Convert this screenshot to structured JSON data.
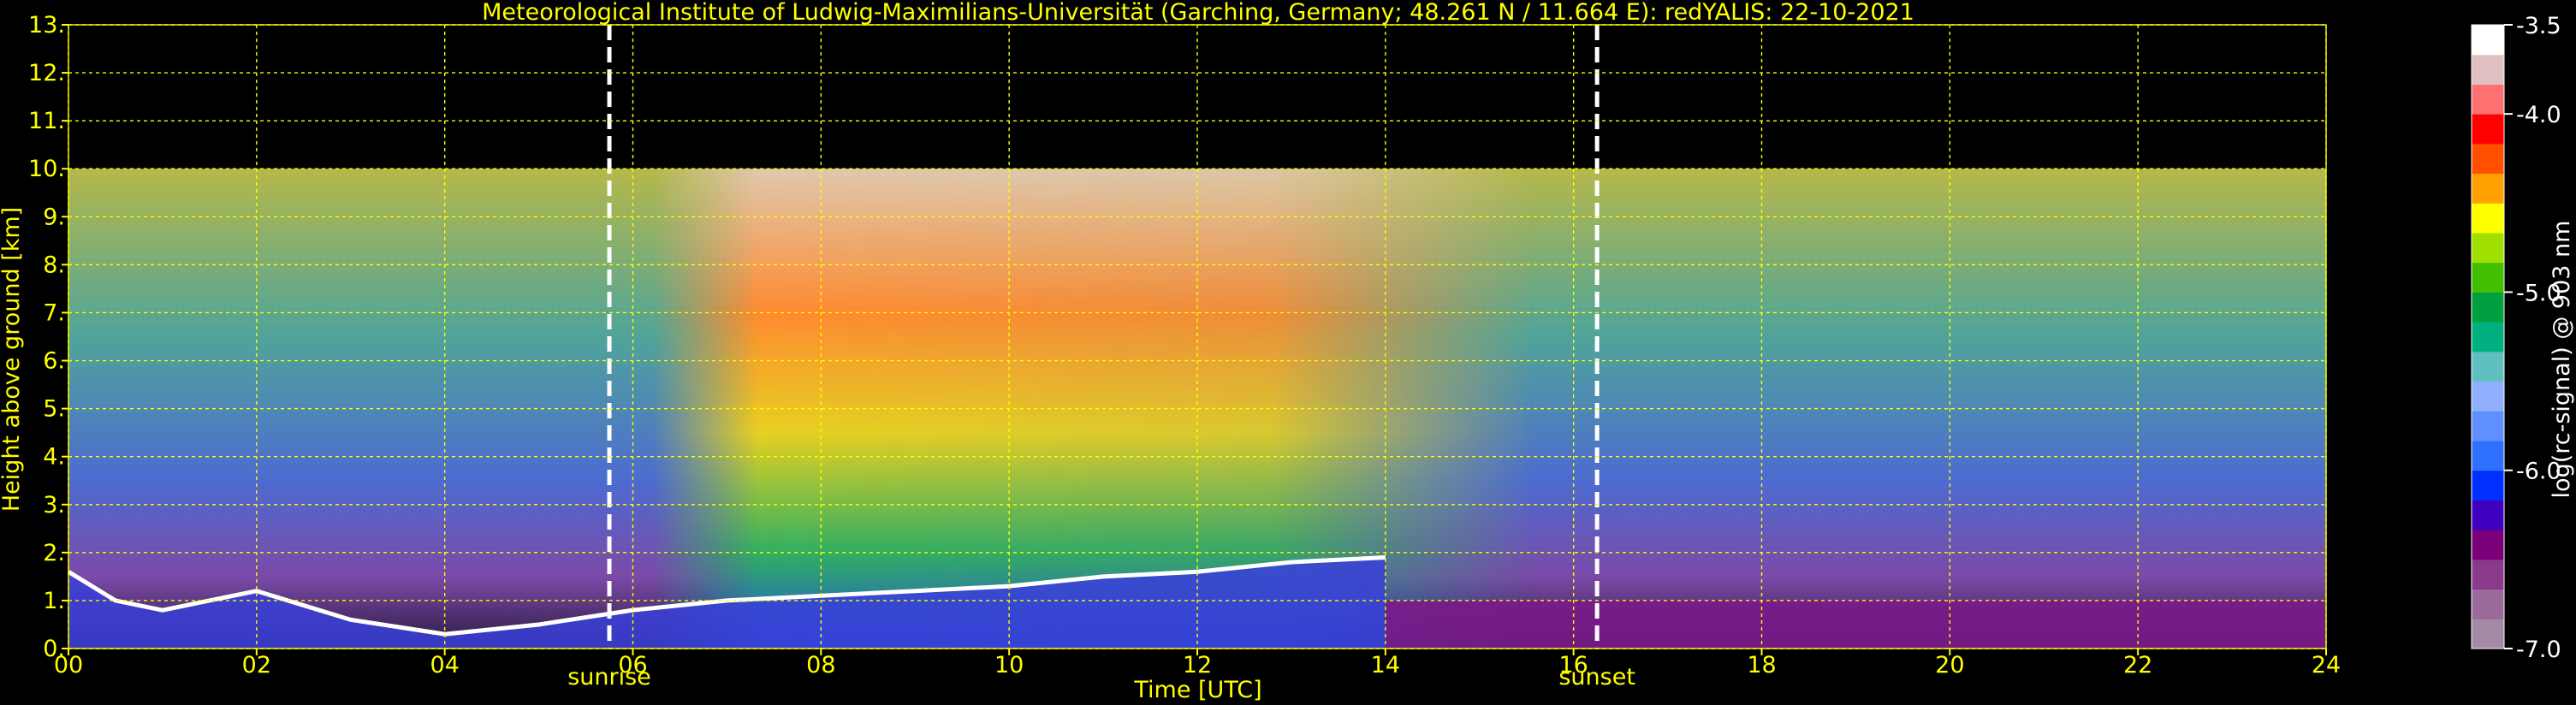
{
  "chart_data": {
    "type": "heatmap",
    "title": "Meteorological Institute of Ludwig-Maximilians-Universität (Garching, Germany; 48.261 N / 11.664 E):    redYALIS: 22-10-2021",
    "xlabel": "Time [UTC]",
    "ylabel": "Height above ground [km]",
    "xlim": [
      0,
      24
    ],
    "ylim": [
      0,
      13
    ],
    "data_top_km": 10,
    "x_ticks": [
      {
        "v": 0,
        "label": "00"
      },
      {
        "v": 2,
        "label": "02"
      },
      {
        "v": 4,
        "label": "04"
      },
      {
        "v": 6,
        "label": "06"
      },
      {
        "v": 8,
        "label": "08"
      },
      {
        "v": 10,
        "label": "10"
      },
      {
        "v": 12,
        "label": "12"
      },
      {
        "v": 14,
        "label": "14"
      },
      {
        "v": 16,
        "label": "16"
      },
      {
        "v": 18,
        "label": "18"
      },
      {
        "v": 20,
        "label": "20"
      },
      {
        "v": 22,
        "label": "22"
      },
      {
        "v": 24,
        "label": "24"
      }
    ],
    "y_ticks": [
      {
        "v": 0,
        "label": "0."
      },
      {
        "v": 1,
        "label": "1."
      },
      {
        "v": 2,
        "label": "2."
      },
      {
        "v": 3,
        "label": "3."
      },
      {
        "v": 4,
        "label": "4."
      },
      {
        "v": 5,
        "label": "5."
      },
      {
        "v": 6,
        "label": "6."
      },
      {
        "v": 7,
        "label": "7."
      },
      {
        "v": 8,
        "label": "8."
      },
      {
        "v": 9,
        "label": "9."
      },
      {
        "v": 10,
        "label": "10."
      },
      {
        "v": 11,
        "label": "11."
      },
      {
        "v": 12,
        "label": "12."
      },
      {
        "v": 13,
        "label": "13."
      }
    ],
    "grid": true,
    "events": [
      {
        "name": "sunrise",
        "time": 5.75
      },
      {
        "name": "sunset",
        "time": 16.25
      }
    ],
    "boundary_layer_top_km": [
      [
        0.0,
        1.6
      ],
      [
        0.5,
        1.0
      ],
      [
        1.0,
        0.8
      ],
      [
        2.0,
        1.2
      ],
      [
        3.0,
        0.6
      ],
      [
        4.0,
        0.3
      ],
      [
        5.0,
        0.5
      ],
      [
        6.0,
        0.8
      ],
      [
        7.0,
        1.0
      ],
      [
        8.0,
        1.1
      ],
      [
        9.0,
        1.2
      ],
      [
        10.0,
        1.3
      ],
      [
        11.0,
        1.5
      ],
      [
        12.0,
        1.6
      ],
      [
        13.0,
        1.8
      ],
      [
        14.0,
        1.9
      ]
    ],
    "colorbar": {
      "label": "log(rc-signal) @ 903 nm",
      "min": -7.0,
      "max": -3.5,
      "tick_labels": [
        "-3.5",
        "-4.0",
        "-5.0",
        "-6.0",
        "-7.0"
      ],
      "tick_values": [
        -3.5,
        -4.0,
        -5.0,
        -6.0,
        -7.0
      ],
      "colors": [
        "#a58aa5",
        "#9a6a9a",
        "#8a3a8a",
        "#7a007a",
        "#4000c0",
        "#0030ff",
        "#3070ff",
        "#6090ff",
        "#90b0ff",
        "#60c0c0",
        "#00b080",
        "#00a040",
        "#40c000",
        "#a0e000",
        "#ffff00",
        "#ffa000",
        "#ff5000",
        "#ff0000",
        "#ff7070",
        "#e0c0c0",
        "#ffffff"
      ]
    }
  }
}
